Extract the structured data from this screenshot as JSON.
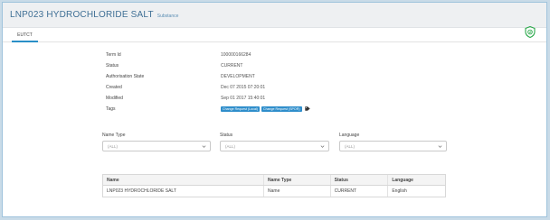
{
  "header": {
    "title": "LNP023 HYDROCHLORIDE SALT",
    "subtitle": "Substance"
  },
  "tabs": [
    {
      "label": "EUTCT"
    }
  ],
  "details": [
    {
      "key": "Term Id",
      "value": "100000166284"
    },
    {
      "key": "Status",
      "value": "CURRENT"
    },
    {
      "key": "Authorisation State",
      "value": "DEVELOPMENT"
    },
    {
      "key": "Created",
      "value": "Dec 07 2015 07:20:01"
    },
    {
      "key": "Modified",
      "value": "Sep 01 2017 15:40:01"
    },
    {
      "key": "Tags",
      "value": ""
    }
  ],
  "tags": [
    "Change Request (Local)",
    "Change Request (SPOR)"
  ],
  "filters": {
    "name_type": {
      "label": "Name Type",
      "value": "(ALL)"
    },
    "status": {
      "label": "Status",
      "value": "(ALL)"
    },
    "language": {
      "label": "Language",
      "value": "(ALL)"
    }
  },
  "table": {
    "columns": [
      "Name",
      "Name Type",
      "Status",
      "Language"
    ],
    "rows": [
      [
        "LNP023 HYDROCHLORIDE SALT",
        "Name",
        "CURRENT",
        "English"
      ]
    ]
  },
  "colors": {
    "accent": "#2f8ecb",
    "shield": "#2aa84a",
    "title": "#3f6f95"
  },
  "icons": {
    "shield": "shield-check-icon",
    "tag": "tag-icon",
    "chevron": "chevron-down-icon"
  }
}
